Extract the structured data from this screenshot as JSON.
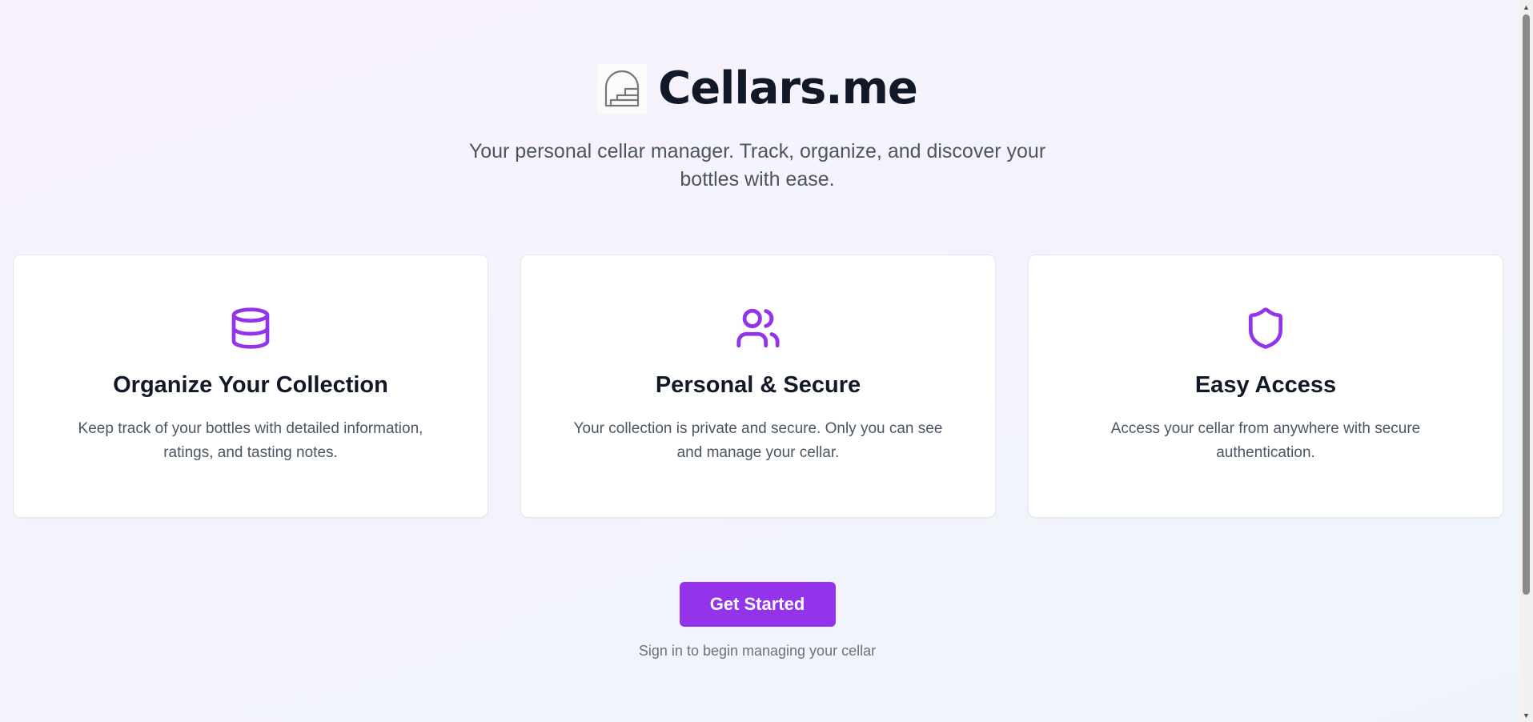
{
  "app": {
    "title": "Cellars.me",
    "tagline": "Your personal cellar manager. Track, organize, and discover your bottles with ease.",
    "logo_icon": "cellar-door-icon"
  },
  "features": [
    {
      "icon": "database-icon",
      "title": "Organize Your Collection",
      "description": "Keep track of your bottles with detailed information, ratings, and tasting notes."
    },
    {
      "icon": "users-icon",
      "title": "Personal & Secure",
      "description": "Your collection is private and secure. Only you can see and manage your cellar."
    },
    {
      "icon": "shield-icon",
      "title": "Easy Access",
      "description": "Access your cellar from anywhere with secure authentication."
    }
  ],
  "cta": {
    "button_label": "Get Started",
    "hint": "Sign in to begin managing your cellar"
  },
  "colors": {
    "accent": "#9333ea",
    "heading": "#111827",
    "body_text": "#4b5563",
    "muted_text": "#6b7280",
    "card_border": "#e5e7eb"
  }
}
